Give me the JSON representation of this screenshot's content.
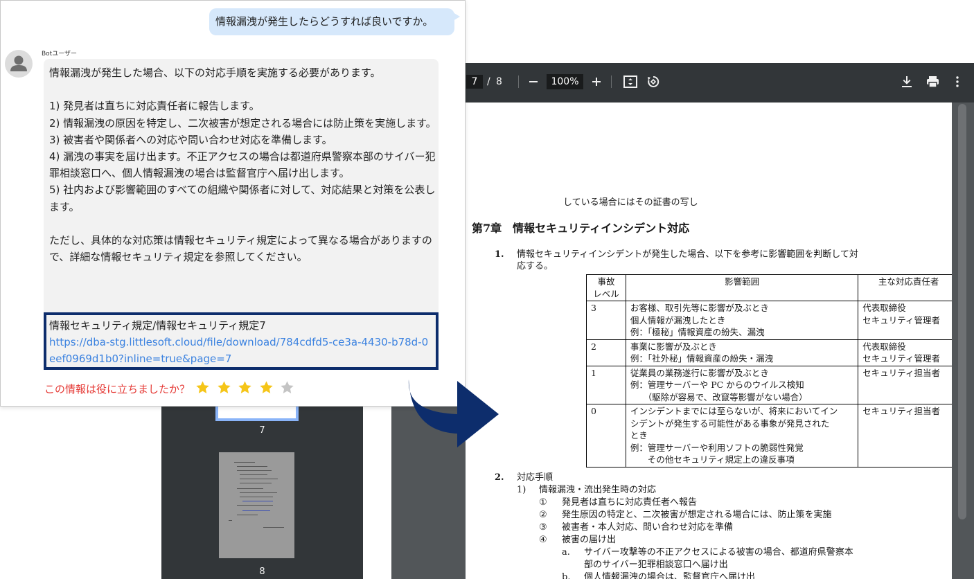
{
  "pdf_viewer": {
    "current_page": "7",
    "page_separator": "/",
    "total_pages": "8",
    "zoom": "100%"
  },
  "thumbnails": {
    "items": [
      {
        "label": "7"
      },
      {
        "label": "8"
      }
    ]
  },
  "document": {
    "top_fragment": "している場合にはその証書の写し",
    "chapter_title": "第7章　情報セキュリティインシデント対応",
    "section1": {
      "number": "1.",
      "text_line1": "情報セキュリティインシデントが発生した場合、以下を参考に影響範囲を判断して対",
      "text_line2": "応する。"
    },
    "table": {
      "headers": [
        "事故\nレベル",
        "影響範囲",
        "主な対応責任者"
      ],
      "rows": [
        {
          "level": "3",
          "scope": "お客様、取引先等に影響が及ぶとき\n個人情報が漏洩したとき\n例：「極秘」情報資産の紛失、漏洩",
          "responsible": "代表取締役\nセキュリティ管理者"
        },
        {
          "level": "2",
          "scope": "事業に影響が及ぶとき\n例：「社外秘」情報資産の紛失・漏洩",
          "responsible": "代表取締役\nセキュリティ管理者"
        },
        {
          "level": "1",
          "scope": "従業員の業務遂行に影響が及ぶとき\n例：管理サーバーや PC からのウイルス検知\n　　（駆除が容易で、改竄等影響がない場合）",
          "responsible": "セキュリティ担当者"
        },
        {
          "level": "0",
          "scope": "インシデントまでには至らないが、将来においてイン\nシデントが発生する可能性がある事象が発見された\nとき\n例：管理サーバーや利用ソフトの脆弱性発覚\n　　その他セキュリティ規定上の違反事項",
          "responsible": "セキュリティ担当者"
        }
      ]
    },
    "section2": {
      "number": "2.",
      "title": "対応手順",
      "sub1_num": "1)",
      "sub1_title": "情報漏洩・流出発生時の対応",
      "steps": [
        {
          "num": "①",
          "text": "発見者は直ちに対応責任者へ報告"
        },
        {
          "num": "②",
          "text": "発生原因の特定と、二次被害が想定される場合には、防止策を実施"
        },
        {
          "num": "③",
          "text": "被害者・本人対応、問い合わせ対応を準備"
        },
        {
          "num": "④",
          "text": "被害の届け出"
        }
      ],
      "sub_a_num": "a.",
      "sub_a_line1": "サイバー攻撃等の不正アクセスによる被害の場合、都道府県警察本",
      "sub_a_line2": "部のサイバー犯罪相談窓口へ届け出",
      "sub_b_num": "b.",
      "sub_b_text": "個人情報漏洩の場合は、監督官庁へ届け出"
    }
  },
  "chat": {
    "user_message": "情報漏洩が発生したらどうすれば良いですか。",
    "bot_name": "Botユーザー",
    "bot_paragraphs": [
      "情報漏洩が発生した場合、以下の対応手順を実施する必要があります。",
      "",
      "1) 発見者は直ちに対応責任者に報告します。",
      "2) 情報漏洩の原因を特定し、二次被害が想定される場合には防止策を実施します。",
      "3) 被害者や関係者への対応や問い合わせ対応を準備します。",
      "4) 漏洩の事実を届け出ます。不正アクセスの場合は都道府県警察本部のサイバー犯罪相談窓口へ、個人情報漏洩の場合は監督官庁へ届け出します。",
      "5) 社内および影響範囲のすべての組織や関係者に対して、対応結果と対策を公表します。",
      "",
      "ただし、具体的な対応策は情報セキュリティ規定によって異なる場合がありますので、詳細な情報セキュリティ規定を参照してください。"
    ],
    "reference": {
      "title": "情報セキュリティ規定/情報セキュリティ規定7",
      "url": "https://dba-stg.littlesoft.cloud/file/download/784cdfd5-ce3a-4430-b78d-0eef0969d1b0?inline=true&page=7"
    },
    "feedback": {
      "question": "この情報は役に立ちましたか？",
      "rating": 4,
      "max_rating": 5,
      "star_filled_color": "#f5c518",
      "star_empty_color": "#c4c4c4"
    }
  },
  "colors": {
    "accent_dark_blue": "#0d2d6c",
    "link_blue": "#3b82e0",
    "user_bubble": "#d6e8fb",
    "feedback_red": "#e53935"
  }
}
